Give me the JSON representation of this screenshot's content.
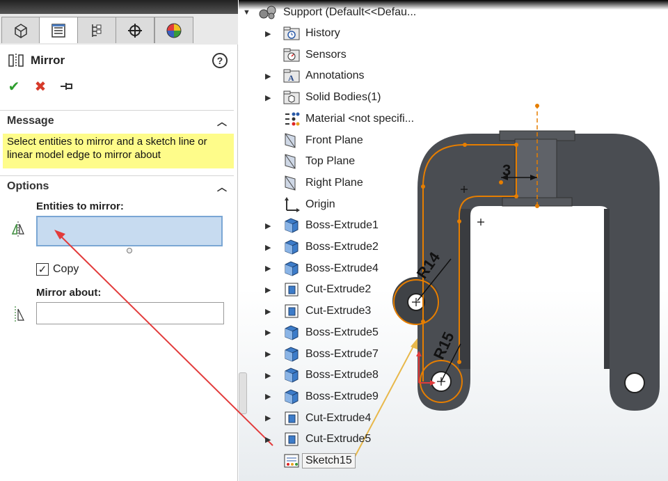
{
  "property_manager": {
    "tabs": [
      "feature-manager-icon",
      "property-manager-icon",
      "configuration-manager-icon",
      "dimxpert-icon",
      "display-manager-icon"
    ],
    "title": "Mirror",
    "help": "?",
    "message_section": {
      "header": "Message",
      "text": "Select entities to mirror and a sketch line or linear model edge to mirror about"
    },
    "options_section": {
      "header": "Options",
      "entities_label": "Entities to mirror:",
      "entities_value": "",
      "copy_label": "Copy",
      "copy_checked": true,
      "mirror_about_label": "Mirror about:",
      "mirror_about_value": ""
    }
  },
  "tree": {
    "root": "Support  (Default<<Defau...",
    "items": [
      {
        "label": "History",
        "icon": "history-folder-icon",
        "expand": true
      },
      {
        "label": "Sensors",
        "icon": "sensors-folder-icon",
        "expand": false
      },
      {
        "label": "Annotations",
        "icon": "annotations-folder-icon",
        "expand": true
      },
      {
        "label": "Solid Bodies(1)",
        "icon": "solid-bodies-folder-icon",
        "expand": true
      },
      {
        "label": "Material <not specifi...",
        "icon": "material-icon",
        "expand": false
      },
      {
        "label": "Front Plane",
        "icon": "plane-icon",
        "expand": false
      },
      {
        "label": "Top Plane",
        "icon": "plane-icon",
        "expand": false
      },
      {
        "label": "Right Plane",
        "icon": "plane-icon",
        "expand": false
      },
      {
        "label": "Origin",
        "icon": "origin-icon",
        "expand": false
      },
      {
        "label": "Boss-Extrude1",
        "icon": "boss-extrude-icon",
        "expand": true
      },
      {
        "label": "Boss-Extrude2",
        "icon": "boss-extrude-icon",
        "expand": true
      },
      {
        "label": "Boss-Extrude4",
        "icon": "boss-extrude-icon",
        "expand": true
      },
      {
        "label": "Cut-Extrude2",
        "icon": "cut-extrude-icon",
        "expand": true
      },
      {
        "label": "Cut-Extrude3",
        "icon": "cut-extrude-icon",
        "expand": true
      },
      {
        "label": "Boss-Extrude5",
        "icon": "boss-extrude-icon",
        "expand": true
      },
      {
        "label": "Boss-Extrude7",
        "icon": "boss-extrude-icon",
        "expand": true
      },
      {
        "label": "Boss-Extrude8",
        "icon": "boss-extrude-icon",
        "expand": true
      },
      {
        "label": "Boss-Extrude9",
        "icon": "boss-extrude-icon",
        "expand": true
      },
      {
        "label": "Cut-Extrude4",
        "icon": "cut-extrude-icon",
        "expand": true
      },
      {
        "label": "Cut-Extrude5",
        "icon": "cut-extrude-icon",
        "expand": true
      },
      {
        "label": "Sketch15",
        "icon": "sketch-icon",
        "expand": false
      }
    ]
  },
  "model": {
    "dims": [
      "3",
      "R14",
      "R15"
    ],
    "body_color": "#4a4d52",
    "sketch_color": "#e67e00"
  },
  "colors": {
    "message_bg": "#fefc8a",
    "field_active": "#c7dbf0",
    "annotation_red": "#e23b3b",
    "annotation_yellow": "#e8b84a"
  }
}
